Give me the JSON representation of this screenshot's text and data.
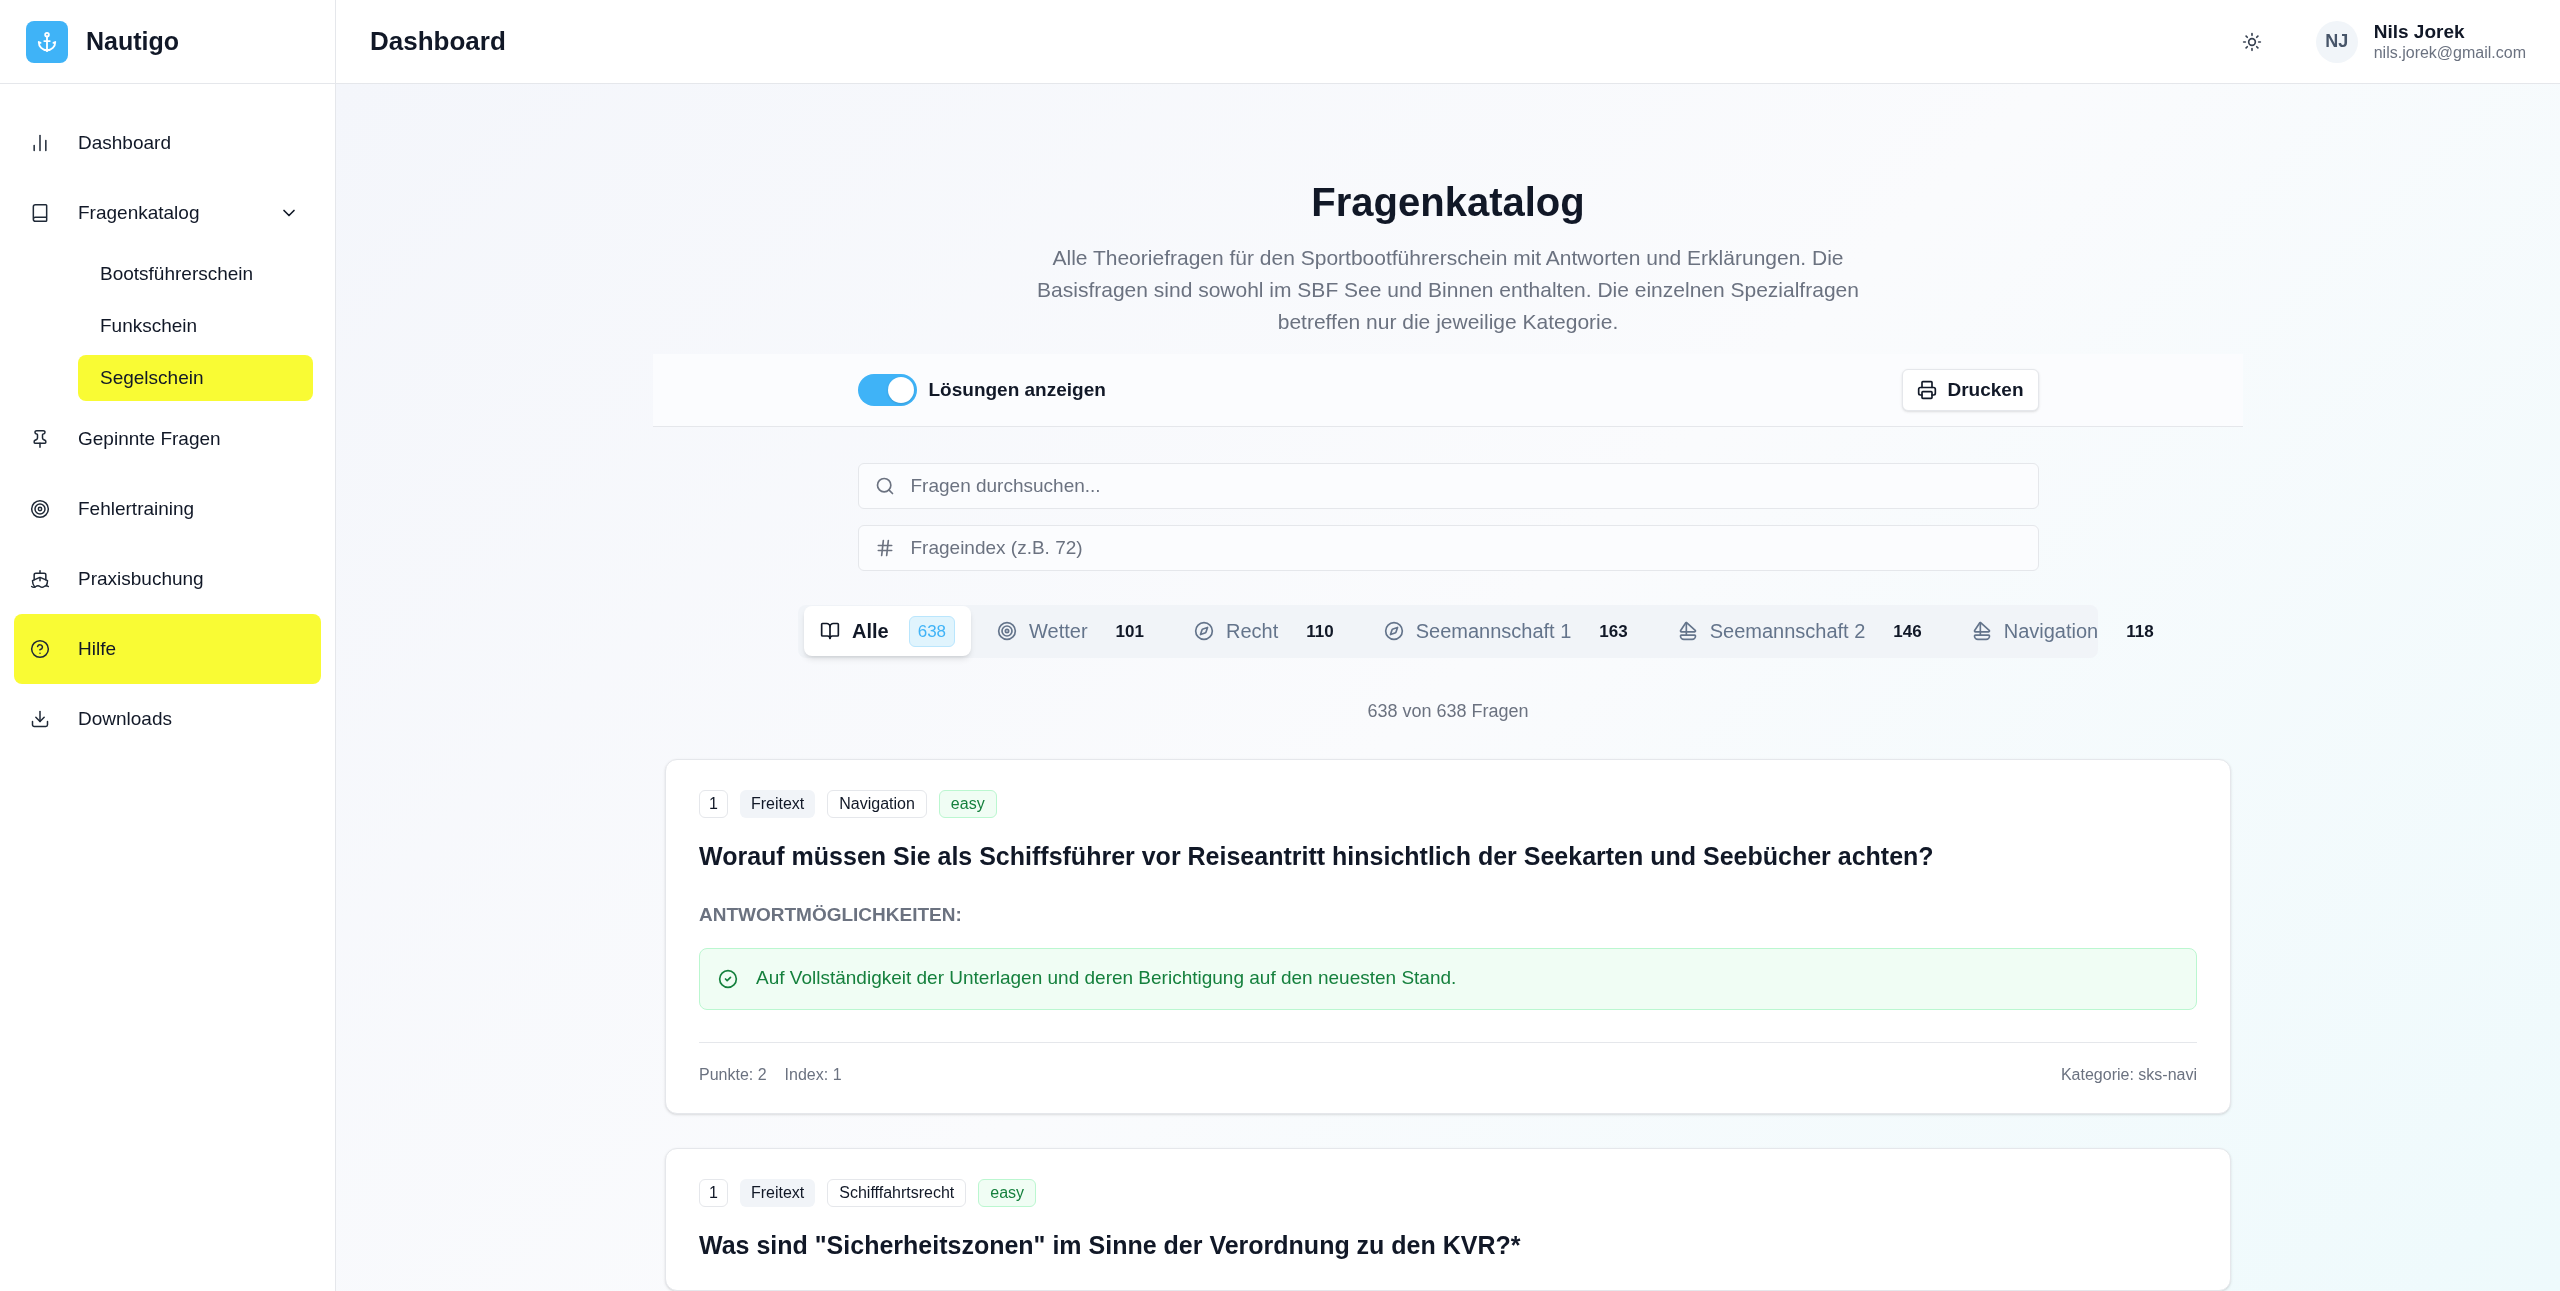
{
  "app": {
    "name": "Nautigo"
  },
  "sidebar": {
    "items": [
      {
        "label": "Dashboard",
        "highlighted": false
      },
      {
        "label": "Fragenkatalog",
        "highlighted": false,
        "expanded": true,
        "children": [
          {
            "label": "Bootsführerschein",
            "highlighted": false
          },
          {
            "label": "Funkschein",
            "highlighted": false
          },
          {
            "label": "Segelschein",
            "highlighted": true
          }
        ]
      },
      {
        "label": "Gepinnte Fragen",
        "highlighted": false
      },
      {
        "label": "Fehlertraining",
        "highlighted": false
      },
      {
        "label": "Praxisbuchung",
        "highlighted": false
      },
      {
        "label": "Hilfe",
        "highlighted": true
      },
      {
        "label": "Downloads",
        "highlighted": false
      }
    ]
  },
  "header": {
    "title": "Dashboard",
    "user": {
      "initials": "NJ",
      "name": "Nils Jorek",
      "email": "nils.jorek@gmail.com"
    }
  },
  "page": {
    "title": "Fragenkatalog",
    "description": "Alle Theoriefragen für den Sportbootführerschein mit Antworten und Erklärungen. Die Basisfragen sind sowohl im SBF See und Binnen enthalten. Die einzelnen Spezialfragen betreffen nur die jeweilige Kategorie."
  },
  "toolbar": {
    "toggle": {
      "label": "Lösungen anzeigen",
      "on": true
    },
    "print_button": "Drucken"
  },
  "search": {
    "placeholder": "Fragen durchsuchen..."
  },
  "index_search": {
    "placeholder": "Frageindex (z.B. 72)"
  },
  "tabs": [
    {
      "label": "Alle",
      "count": "638",
      "selected": true
    },
    {
      "label": "Wetter",
      "count": "101",
      "selected": false
    },
    {
      "label": "Recht",
      "count": "110",
      "selected": false
    },
    {
      "label": "Seemannschaft 1",
      "count": "163",
      "selected": false
    },
    {
      "label": "Seemannschaft 2",
      "count": "146",
      "selected": false
    },
    {
      "label": "Navigation",
      "count": "118",
      "selected": false
    }
  ],
  "result_count": "638 von 638 Fragen",
  "questions": [
    {
      "number": "1",
      "type": "Freitext",
      "category": "Navigation",
      "difficulty": "easy",
      "question": "Worauf müssen Sie als Schiffsführer vor Reiseantritt hinsichtlich der Seekarten und Seebücher achten?",
      "answers_label": "ANTWORTMÖGLICHKEITEN:",
      "answers": [
        {
          "text": "Auf Vollständigkeit der Unterlagen und deren Berichtigung auf den neuesten Stand.",
          "correct": true
        }
      ],
      "points": "Punkte: 2",
      "index": "Index: 1",
      "category_code": "Kategorie: sks-navi"
    },
    {
      "number": "1",
      "type": "Freitext",
      "category": "Schifffahrtsrecht",
      "difficulty": "easy",
      "question": "Was sind \"Sicherheitszonen\" im Sinne der Verordnung zu den KVR?*"
    }
  ]
}
